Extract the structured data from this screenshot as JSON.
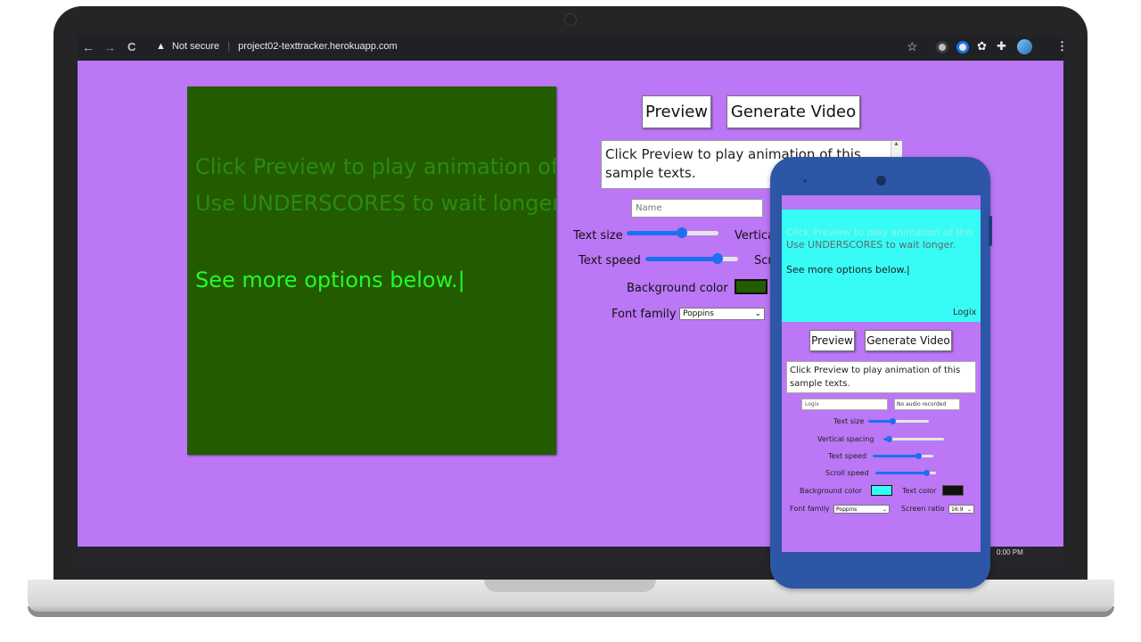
{
  "browser": {
    "security_label": "Not secure",
    "url": "project02-texttracker.herokuapp.com",
    "nav": {
      "back": "←",
      "forward": "→",
      "reload": "C",
      "warning": "▲"
    },
    "toolbar_icons": [
      "star-icon",
      "extension-icon",
      "extension-icon",
      "extension-icon",
      "puzzle-icon",
      "profile-icon",
      "menu-icon"
    ]
  },
  "taskbar": {
    "clock": "0:00 PM"
  },
  "canvas": {
    "background": "#235b00",
    "lines": [
      {
        "text": "Click Preview to play animation of this",
        "color": "#2a8b10"
      },
      {
        "text": "Use UNDERSCORES to wait longer.",
        "color": "#2a8b10"
      },
      {
        "text": "See more options below.|",
        "color": "#26fb26"
      }
    ]
  },
  "controls": {
    "preview_label": "Preview",
    "generate_label": "Generate Video",
    "textarea_text": "Click Preview to play animation of this sample texts.",
    "name_placeholder": "Name",
    "text_size_label": "Text size",
    "vertical_spacing_label": "Vertical spacing",
    "text_speed_label": "Text speed",
    "scroll_speed_label": "Scroll speed",
    "bg_color_label": "Background color",
    "font_family_label": "Font family",
    "font_family_value": "Poppins",
    "text_size_value": 0.6,
    "text_speed_value": 0.78,
    "bg_color": "#235b00"
  },
  "phone": {
    "canvas": {
      "background": "#37fbf5",
      "lines": [
        {
          "text": "Click Preview to play animation of this",
          "color": "#8ff3ef"
        },
        {
          "text": "Use UNDERSCORES to wait longer.",
          "color": "#5f6a6a"
        },
        {
          "text": "See more options below.|",
          "color": "#222222"
        }
      ],
      "watermark": "Logix"
    },
    "preview_label": "Preview",
    "generate_label": "Generate Video",
    "textarea_text": "Click Preview to play animation of this sample texts.",
    "name_value": "Logix",
    "audio_label": "No audio recorded",
    "text_size_label": "Text size",
    "vertical_spacing_label": "Vertical spacing",
    "text_speed_label": "Text speed",
    "scroll_speed_label": "Scroll speed",
    "bg_color_label": "Background color",
    "text_color_label": "Text color",
    "font_family_label": "Font family",
    "font_family_value": "Poppins",
    "screen_ratio_label": "Screen ratio",
    "screen_ratio_value": "16:9",
    "bg_color": "#37fbf5",
    "text_color": "#111111",
    "text_size_value": 0.4,
    "vertical_spacing_value": 0.1,
    "text_speed_value": 0.75,
    "scroll_speed_value": 0.85
  },
  "colors": {
    "page_bg": "#bb77f5",
    "slider_accent": "#1e6ff0",
    "phone_body": "#2d56a6"
  }
}
